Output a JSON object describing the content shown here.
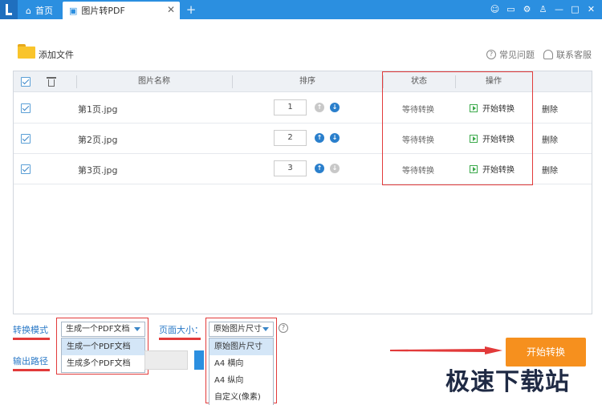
{
  "titlebar": {
    "home_tab": "首页",
    "active_tab": "图片转PDF",
    "close_glyph": "✕",
    "add_tab_glyph": "+",
    "icons": [
      "user-icon",
      "chat-icon",
      "settings-icon",
      "skin-icon",
      "minimize-icon",
      "maximize-icon",
      "close-icon"
    ]
  },
  "toolbar": {
    "add_file_label": "添加文件",
    "faq_label": "常见问题",
    "support_label": "联系客服"
  },
  "table": {
    "headers": {
      "name": "图片名称",
      "order": "排序",
      "status": "状态",
      "action": "操作"
    },
    "rows": [
      {
        "file": "第1页.jpg",
        "order": "1",
        "status": "等待转换",
        "action": "开始转换",
        "delete": "删除",
        "up_enabled": false,
        "down_enabled": true
      },
      {
        "file": "第2页.jpg",
        "order": "2",
        "status": "等待转换",
        "action": "开始转换",
        "delete": "删除",
        "up_enabled": true,
        "down_enabled": true
      },
      {
        "file": "第3页.jpg",
        "order": "3",
        "status": "等待转换",
        "action": "开始转换",
        "delete": "删除",
        "up_enabled": true,
        "down_enabled": false
      }
    ]
  },
  "settings": {
    "mode_label": "转换模式",
    "mode_selected": "生成一个PDF文档",
    "mode_options": [
      "生成一个PDF文档",
      "生成多个PDF文档"
    ],
    "size_label": "页面大小：",
    "size_selected": "原始图片尺寸",
    "size_options": [
      "原始图片尺寸",
      "A4 横向",
      "A4 纵向",
      "自定义(像素)"
    ],
    "output_label": "输出路径",
    "help_glyph": "?"
  },
  "start_button": "开始转换",
  "watermark": "极速下载站",
  "colors": {
    "titlebar": "#2b8fe0",
    "accent_blue": "#2a79c7",
    "annotation_red": "#e23a3a",
    "start_orange": "#f6901e"
  }
}
